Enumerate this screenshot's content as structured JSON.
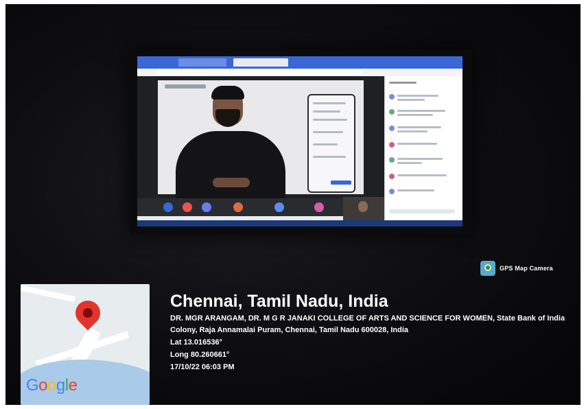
{
  "overlay": {
    "app_badge": "GPS Map Camera",
    "location_title": "Chennai, Tamil Nadu, India",
    "address": "DR. MGR ARANGAM, DR. M G R JANAKI COLLEGE OF ARTS AND SCIENCE FOR WOMEN, State Bank of India Colony, Raja Annamalai Puram, Chennai, Tamil Nadu 600028, India",
    "latitude": "Lat 13.016536°",
    "longitude": "Long 80.260661°",
    "timestamp": "17/10/22 06:03 PM"
  },
  "map": {
    "logo_text": [
      "G",
      "o",
      "o",
      "g",
      "l",
      "e"
    ],
    "logo_colors": [
      "#4285F4",
      "#EA4335",
      "#FBBC05",
      "#4285F4",
      "#34A853",
      "#EA4335"
    ],
    "pin_color": "#e3342c",
    "icon": "location-pin-icon"
  },
  "laptop_screen": {
    "accent": "#3a67d6",
    "icons": [
      "microphone-icon",
      "camera-icon",
      "present-icon",
      "end-call-icon",
      "chat-icon",
      "people-icon"
    ]
  }
}
